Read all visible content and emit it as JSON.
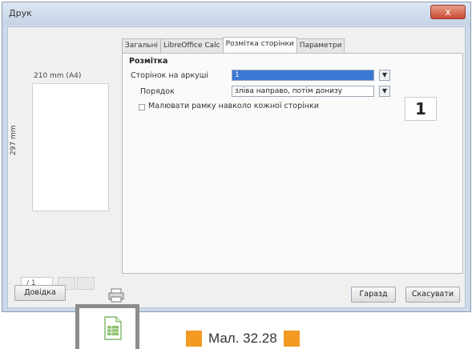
{
  "window": {
    "title": "Друк",
    "close_label": "x"
  },
  "preview": {
    "paper_width": "210 mm (A4)",
    "paper_height": "297 mm",
    "page_counter": "/ 1"
  },
  "tabs": [
    {
      "label": "Загальні"
    },
    {
      "label": "LibreOffice Calc"
    },
    {
      "label": "Розмітка сторінки"
    },
    {
      "label": "Параметри"
    }
  ],
  "layout_panel": {
    "group_title": "Розмітка",
    "pages_per_sheet_label": "Сторінок на аркуші",
    "pages_per_sheet_value": "1",
    "order_label": "Порядок",
    "order_value": "зліва направо, потім донизу",
    "border_checkbox_label": "Малювати рамку навколо кожної сторінки",
    "border_checked": false,
    "preview_number": "1"
  },
  "buttons": {
    "help": "Довідка",
    "ok": "Гаразд",
    "cancel": "Скасувати"
  },
  "caption": {
    "text": "Мал. 32.28",
    "marker_color": "#f29a22"
  },
  "icons": {
    "close": "close-icon",
    "dropdown": "chevron-down-icon",
    "print": "print-icon",
    "document": "calc-document-icon"
  }
}
